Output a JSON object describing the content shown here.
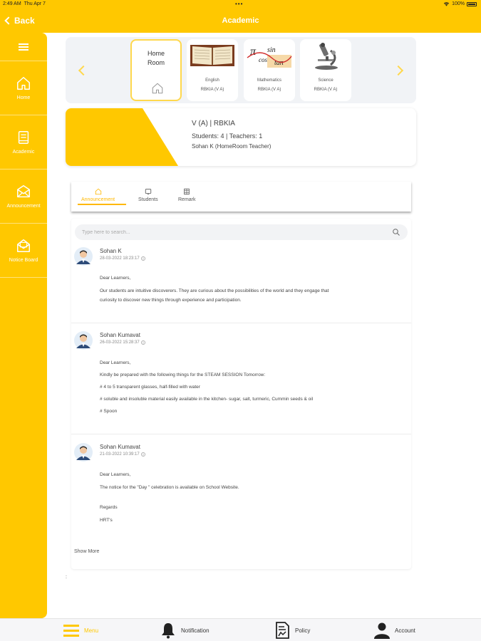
{
  "status_bar": {
    "time": "2:49 AM",
    "date": "Thu Apr 7",
    "dots": "•••",
    "battery": "100%"
  },
  "navbar": {
    "back_label": "Back",
    "title": "Academic"
  },
  "sidebar": {
    "items": [
      {
        "label": "Home",
        "icon": "home-icon"
      },
      {
        "label": "Academic",
        "icon": "book-icon"
      },
      {
        "label": "Announcement",
        "icon": "envelope-icon"
      },
      {
        "label": "Notice Board",
        "icon": "envelope-open-icon"
      }
    ]
  },
  "subjects": {
    "homeroom": {
      "line1": "Home",
      "line2": "Room"
    },
    "cards": [
      {
        "name": "English",
        "section": "RBKIA (V A)"
      },
      {
        "name": "Mathematics",
        "section": "RBKIA (V A)"
      },
      {
        "name": "Science",
        "section": "RBKIA (V A)"
      }
    ]
  },
  "class_info": {
    "title": "V (A) | RBKIA",
    "counts": "Students: 4 | Teachers: 1",
    "teacher": "Sohan K (HomeRoom Teacher)"
  },
  "tabs": [
    {
      "label": "Announcement",
      "active": true
    },
    {
      "label": "Students",
      "active": false
    },
    {
      "label": "Remark",
      "active": false
    }
  ],
  "search": {
    "placeholder": "Type here to search..."
  },
  "posts": [
    {
      "author": "Sohan K",
      "date": "28-03-2022 18:23:17",
      "lines": [
        "Dear Learners,",
        "Our students are intuitive discoverers. They are curious about the possibilities of the world and they engage that",
        "curiosity to discover new things through experience and participation."
      ]
    },
    {
      "author": "Sohan Kumavat",
      "date": "26-03-2022 15:28:37",
      "lines": [
        "Dear Learners,",
        "Kindly be prepared with the following things for the STEAM SESSION Tomorrow:",
        "# 4 to 5 transparent glasses, half-filled with water",
        "# soluble and insoluble material easily available in the kitchen- sugar, salt, turmeric, Cummin seeds & oil",
        "# Spoon"
      ]
    },
    {
      "author": "Sohan Kumavat",
      "date": "21-03-2022 10:39:17",
      "lines": [
        "Dear Learners,",
        "The notice for the \"Day \" celebration is available on School Website.",
        "Regards",
        "HRT's"
      ]
    }
  ],
  "show_more": "Show More",
  "trailing": ":",
  "bottom_bar": [
    {
      "label": "Menu",
      "icon": "menu-icon",
      "active": true
    },
    {
      "label": "Notification",
      "icon": "bell-icon",
      "active": false
    },
    {
      "label": "Policy",
      "icon": "document-icon",
      "active": false
    },
    {
      "label": "Account",
      "icon": "person-icon",
      "active": false
    }
  ],
  "colors": {
    "accent": "#FFC800",
    "active_tab": "#FFB800",
    "panel_bg": "#F1F3F6"
  }
}
